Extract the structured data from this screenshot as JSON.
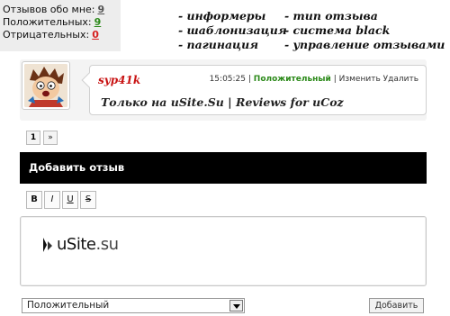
{
  "stats": {
    "about_me_label": "Отзывов обо мне:",
    "about_me_value": "9",
    "positive_label": "Положительных:",
    "positive_value": "9",
    "negative_label": "Отрицательных:",
    "negative_value": "0"
  },
  "features": {
    "col1": [
      "- информеры",
      "- шаблонизация",
      "- пагинация"
    ],
    "col2": [
      "- тип отзыва",
      "- система black",
      "- управление отзывами"
    ]
  },
  "review": {
    "author": "syp41k",
    "time": "15:05:25",
    "separator": "|",
    "type": "Положительный",
    "edit_label": "Изменить",
    "delete_label": "Удалить",
    "text": "Только на uSite.Su | Reviews for uCoz"
  },
  "pagination": {
    "current": "1",
    "next": "»"
  },
  "add_review": {
    "title": "Добавить отзыв"
  },
  "toolbar": {
    "bold": "B",
    "italic": "I",
    "underline": "U",
    "strike": "S"
  },
  "editor": {
    "logo_word": "uSite",
    "logo_suffix": ".su"
  },
  "form": {
    "type_selected": "Положительный",
    "submit_label": "Добавить"
  },
  "colors": {
    "positive": "#2c8a1a",
    "negative": "#d62020",
    "author": "#c81212",
    "bar": "#000000"
  }
}
